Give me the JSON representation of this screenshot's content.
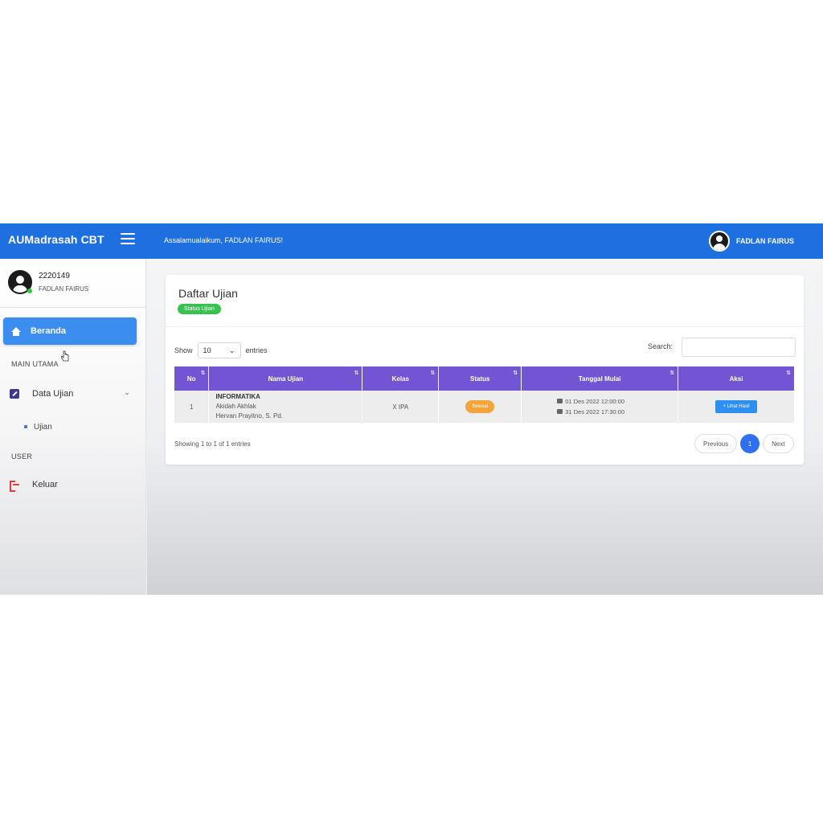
{
  "navbar": {
    "brand": "AUMadrasah CBT",
    "greeting": "Assalamualaikum, FADLAN FAIRUS!",
    "user_name": "FADLAN FAIRUS"
  },
  "sidebar": {
    "user_id": "2220149",
    "user_name": "FADLAN FAIRUS",
    "active_item": "Beranda",
    "section_main": "MAIN UTAMA",
    "data_ujian": "Data Ujian",
    "sub_ujian": "Ujian",
    "section_user": "USER",
    "logout": "Keluar"
  },
  "card": {
    "title": "Daftar Ujian",
    "badge": "Status Ujian"
  },
  "table_controls": {
    "show_label": "Show",
    "entries_value": "10",
    "entries_label": "entries",
    "search_label": "Search:",
    "search_value": ""
  },
  "table": {
    "headers": [
      "No",
      "Nama Ujian",
      "Kelas",
      "Status",
      "Tanggal Mulai",
      "Aksi"
    ],
    "rows": [
      {
        "no": "1",
        "subject": "INFORMATIKA",
        "exam": "Akidah Akhlak",
        "teacher": "Hervan Prayitno, S. Pd.",
        "kelas": "X IPA",
        "status": "Selesai",
        "date_start": "01 Des 2022 12:00:00",
        "date_end": "31 Des 2022 17:30:00",
        "action": "+ Lihat Hasil"
      }
    ]
  },
  "footer": {
    "info": "Showing 1 to 1 of 1 entries",
    "previous": "Previous",
    "page": "1",
    "next": "Next"
  },
  "colors": {
    "navbar": "#1e6fe0",
    "active_menu": "#3b8ef0",
    "table_header": "#7255d3",
    "badge": "#37c24f",
    "status": "#f3a43a",
    "action": "#2d8ff0"
  }
}
